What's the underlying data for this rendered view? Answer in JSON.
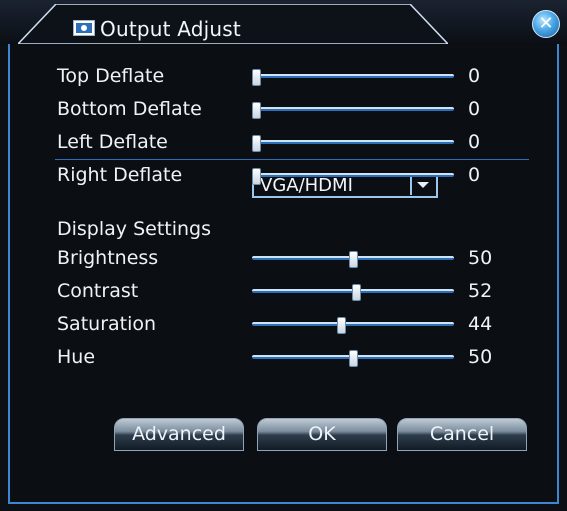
{
  "window": {
    "title": "Output Adjust",
    "title_icon": "monitor-icon",
    "close_icon": "close-icon"
  },
  "deflate": [
    {
      "label": "Top Deflate",
      "value": "0",
      "level": 0
    },
    {
      "label": "Bottom Deflate",
      "value": "0",
      "level": 0
    },
    {
      "label": "Left Deflate",
      "value": "0",
      "level": 0
    },
    {
      "label": "Right Deflate",
      "value": "0",
      "level": 0
    }
  ],
  "display": {
    "label": "Display Settings",
    "selected": "VGA/HDMI"
  },
  "image": [
    {
      "label": "Brightness",
      "value": "50",
      "level": 50
    },
    {
      "label": "Contrast",
      "value": "52",
      "level": 52
    },
    {
      "label": "Saturation",
      "value": "44",
      "level": 44
    },
    {
      "label": "Hue",
      "value": "50",
      "level": 50
    }
  ],
  "buttons": {
    "advanced": "Advanced",
    "ok": "OK",
    "cancel": "Cancel"
  },
  "colors": {
    "accent": "#3f86d2",
    "background": "#0b0e13"
  }
}
